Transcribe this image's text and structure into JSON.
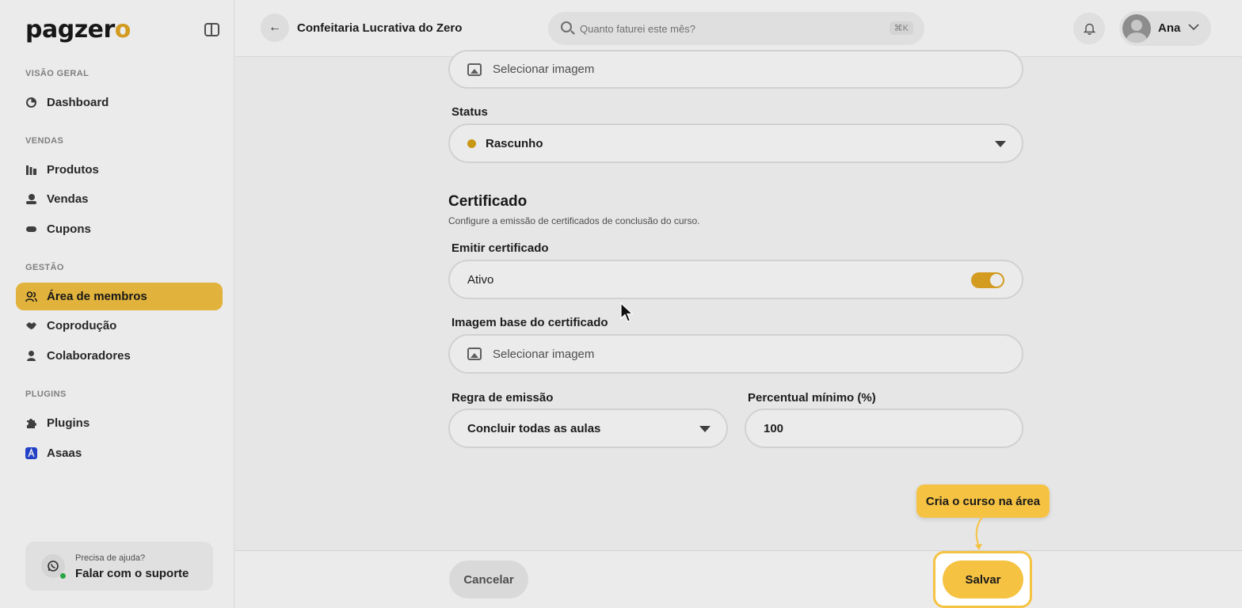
{
  "app": {
    "logo_text": "pagzer",
    "logo_accent": "o"
  },
  "sidebar": {
    "sections": [
      {
        "label": "VISÃO GERAL"
      },
      {
        "label": "VENDAS"
      },
      {
        "label": "GESTÃO"
      },
      {
        "label": "PLUGINS"
      }
    ],
    "items": [
      {
        "label": "Dashboard",
        "icon": "dashboard-icon"
      },
      {
        "label": "Produtos",
        "icon": "products-icon"
      },
      {
        "label": "Vendas",
        "icon": "sales-icon"
      },
      {
        "label": "Cupons",
        "icon": "coupon-icon"
      },
      {
        "label": "Área de membros",
        "icon": "members-icon",
        "active": true
      },
      {
        "label": "Coprodução",
        "icon": "handshake-icon"
      },
      {
        "label": "Colaboradores",
        "icon": "user-icon"
      },
      {
        "label": "Plugins",
        "icon": "puzzle-icon"
      },
      {
        "label": "Asaas",
        "icon": "asaas-icon"
      }
    ],
    "help": {
      "title": "Precisa de ajuda?",
      "link": "Falar com o suporte"
    }
  },
  "header": {
    "title": "Confeitaria Lucrativa do Zero",
    "search_placeholder": "Quanto faturei este mês?",
    "search_shortcut": "⌘K",
    "user_name": "Ana"
  },
  "form": {
    "top_image_picker": "Selecionar imagem",
    "status_label": "Status",
    "status_value": "Rascunho",
    "certificate": {
      "title": "Certificado",
      "description": "Configure a emissão de certificados de conclusão do curso.",
      "emit_label": "Emitir certificado",
      "emit_value": "Ativo",
      "emit_enabled": true,
      "base_image_label": "Imagem base do certificado",
      "base_image_picker": "Selecionar imagem",
      "rule_label": "Regra de emissão",
      "rule_value": "Concluir todas as aulas",
      "min_percent_label": "Percentual mínimo (%)",
      "min_percent_value": "100"
    }
  },
  "footer": {
    "cancel_label": "Cancelar",
    "save_label": "Salvar"
  },
  "tutorial": {
    "tooltip_text": "Cria o curso na área"
  },
  "colors": {
    "accent": "#f5c242",
    "status_draft": "#d9a516",
    "online": "#2db44a"
  }
}
